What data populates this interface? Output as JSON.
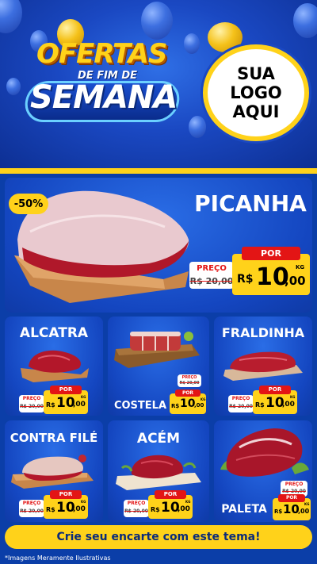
{
  "header": {
    "title_top": "OFERTAS",
    "title_middle": "DE FIM DE",
    "title_bottom": "SEMANA",
    "logo_lines": [
      "SUA",
      "LOGO",
      "AQUI"
    ]
  },
  "featured": {
    "discount": "-50%",
    "name": "PICANHA",
    "old_label": "PREÇO",
    "old_price": "R$ 20,00",
    "new_label": "POR",
    "currency": "R$",
    "price_int": "10",
    "price_cents": ",00",
    "unit": "KG",
    "image_icon": "picanha-meat-icon"
  },
  "products": [
    {
      "name": "ALCATRA",
      "old_label": "PREÇO",
      "old_price": "R$ 20,00",
      "new_label": "POR",
      "currency": "R$",
      "price_int": "10",
      "price_cents": ",00",
      "unit": "KG"
    },
    {
      "name": "COSTELA",
      "old_label": "PREÇO",
      "old_price": "R$ 20,00",
      "new_label": "POR",
      "currency": "R$",
      "price_int": "10",
      "price_cents": ",00",
      "unit": "KG"
    },
    {
      "name": "FRALDINHA",
      "old_label": "PREÇO",
      "old_price": "R$ 20,00",
      "new_label": "POR",
      "currency": "R$",
      "price_int": "10",
      "price_cents": ",00",
      "unit": "KG"
    },
    {
      "name": "CONTRA FILÉ",
      "old_label": "PREÇO",
      "old_price": "R$ 20,00",
      "new_label": "POR",
      "currency": "R$",
      "price_int": "10",
      "price_cents": ",00",
      "unit": "KG"
    },
    {
      "name": "ACÉM",
      "old_label": "PREÇO",
      "old_price": "R$ 20,00",
      "new_label": "POR",
      "currency": "R$",
      "price_int": "10",
      "price_cents": ",00",
      "unit": "KG"
    },
    {
      "name": "PALETA",
      "old_label": "PREÇO",
      "old_price": "R$ 20,00",
      "new_label": "POR",
      "currency": "R$",
      "price_int": "10",
      "price_cents": ",00",
      "unit": "KG"
    }
  ],
  "cta": "Crie seu encarte com este tema!",
  "footnote": "*Imagens Meramente Ilustrativas",
  "colors": {
    "accent": "#ffd21a",
    "brand_blue": "#1446c0",
    "sale_red": "#e31515"
  }
}
